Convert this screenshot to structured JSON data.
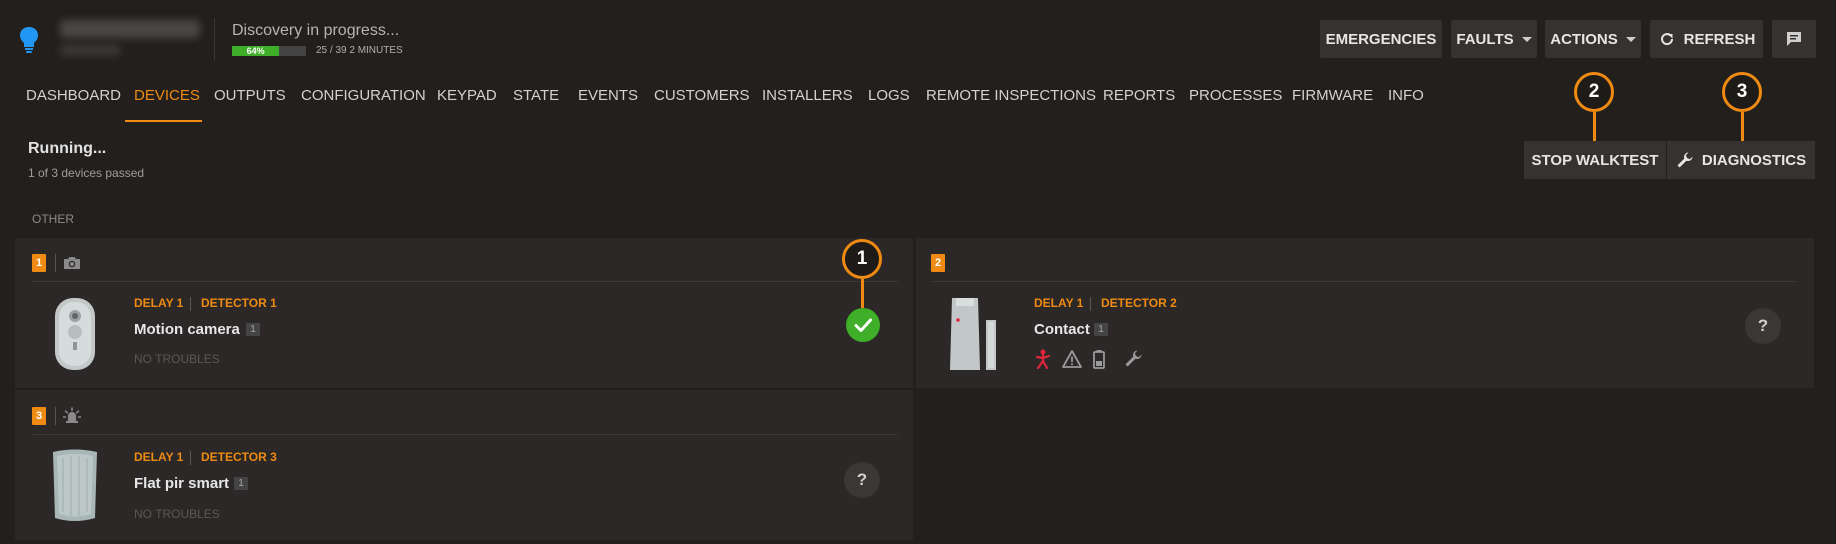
{
  "header": {
    "status_text": "Discovery in progress...",
    "progress_percent": 64,
    "progress_label": "64%",
    "progress_detail": "25 / 39 2 MINUTES",
    "buttons": {
      "emergencies": "EMERGENCIES",
      "faults": "FAULTS",
      "actions": "ACTIONS",
      "refresh": "REFRESH"
    }
  },
  "nav": {
    "items": [
      "DASHBOARD",
      "DEVICES",
      "OUTPUTS",
      "CONFIGURATION",
      "KEYPAD",
      "STATE",
      "EVENTS",
      "CUSTOMERS",
      "INSTALLERS",
      "LOGS",
      "REMOTE INSPECTIONS",
      "REPORTS",
      "PROCESSES",
      "FIRMWARE",
      "INFO"
    ],
    "active": "DEVICES"
  },
  "walktest": {
    "status": "Running...",
    "summary": "1 of 3 devices passed",
    "stop_label": "STOP WALKTEST",
    "diagnostics_label": "DIAGNOSTICS"
  },
  "markers": [
    "1",
    "2",
    "3"
  ],
  "section_label": "OTHER",
  "devices": [
    {
      "number": "1",
      "type_icon": "camera-icon",
      "delay": "DELAY 1",
      "detector": "DETECTOR 1",
      "name": "Motion camera",
      "badge": "1",
      "troubles": "NO TROUBLES",
      "status": "passed"
    },
    {
      "number": "2",
      "type_icon": "none",
      "delay": "DELAY 1",
      "detector": "DETECTOR 2",
      "name": "Contact",
      "badge": "1",
      "troubles": "",
      "trouble_icons": [
        "intrusion-icon",
        "warning-icon",
        "battery-icon",
        "wrench-icon"
      ],
      "status": "unknown",
      "status_label": "?"
    },
    {
      "number": "3",
      "type_icon": "siren-light-icon",
      "delay": "DELAY 1",
      "detector": "DETECTOR 3",
      "name": "Flat pir smart",
      "badge": "1",
      "troubles": "NO TROUBLES",
      "status": "unknown",
      "status_label": "?"
    }
  ],
  "colors": {
    "accent": "#ef8a12",
    "success": "#3fae29",
    "alarm": "#e0263c",
    "bulb": "#2196f3"
  }
}
